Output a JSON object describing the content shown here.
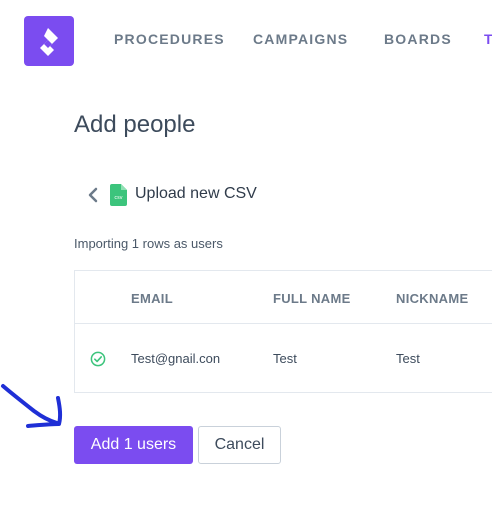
{
  "nav": {
    "items": [
      {
        "label": "PROCEDURES"
      },
      {
        "label": "CAMPAIGNS"
      },
      {
        "label": "BOARDS"
      },
      {
        "label": "T"
      }
    ],
    "brand_color": "#7b4cf0"
  },
  "page": {
    "title": "Add people",
    "upload_label": "Upload new CSV",
    "csv_icon_text": "csv",
    "import_summary": "Importing 1 rows as users"
  },
  "table": {
    "columns": [
      "EMAIL",
      "FULL NAME",
      "NICKNAME"
    ],
    "rows": [
      {
        "status": "valid",
        "email": "Test@gnail.con",
        "full_name": "Test",
        "nickname": "Test"
      }
    ]
  },
  "actions": {
    "primary_label": "Add 1 users",
    "secondary_label": "Cancel"
  },
  "colors": {
    "accent": "#7b4cf0",
    "success": "#3cc47c",
    "annotation": "#1f2fd6"
  }
}
